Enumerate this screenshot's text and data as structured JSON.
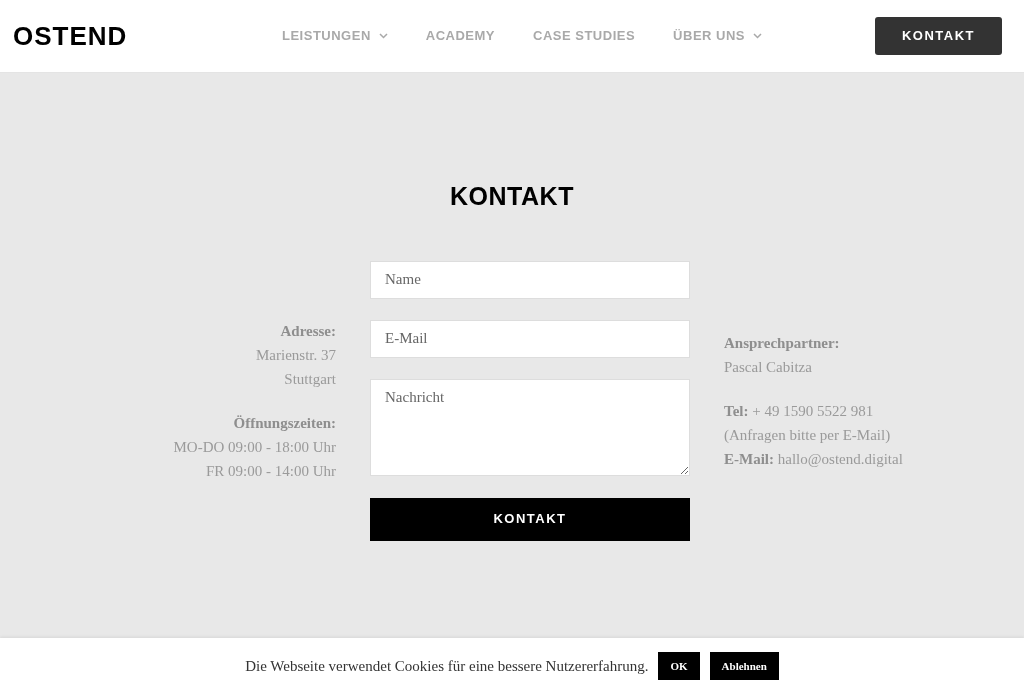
{
  "header": {
    "logo": "OSTEND",
    "nav": [
      {
        "label": "LEISTUNGEN",
        "has_menu": true
      },
      {
        "label": "ACADEMY",
        "has_menu": false
      },
      {
        "label": "CASE STUDIES",
        "has_menu": false
      },
      {
        "label": "ÜBER UNS",
        "has_menu": true
      }
    ],
    "cta": "KONTAKT"
  },
  "contact": {
    "title": "KONTAKT",
    "left_info": [
      [
        {
          "kind": "heading",
          "text": "Adresse:"
        },
        {
          "kind": "text",
          "text": "Marienstr. 37"
        },
        {
          "kind": "text",
          "text": "Stuttgart"
        }
      ],
      [
        {
          "kind": "heading",
          "text": "Öffnungszeiten:"
        },
        {
          "kind": "text",
          "text": "MO-DO 09:00 - 18:00 Uhr"
        },
        {
          "kind": "text",
          "text": "FR 09:00 - 14:00 Uhr"
        }
      ]
    ],
    "form": {
      "fields": [
        {
          "kind": "input",
          "placeholder": "Name"
        },
        {
          "kind": "input",
          "placeholder": "E-Mail"
        },
        {
          "kind": "textarea",
          "placeholder": "Nachricht"
        }
      ],
      "submit": "KONTAKT"
    },
    "right_info": [
      [
        {
          "kind": "heading",
          "text": "Ansprechpartner:"
        },
        {
          "kind": "text",
          "text": "Pascal Cabitza"
        }
      ],
      [
        {
          "kind": "text",
          "text": "**Tel:** + 49 1590 5522 981"
        },
        {
          "kind": "text",
          "text": "(Anfragen bitte per E-Mail)"
        },
        {
          "kind": "text",
          "text": "**E-Mail:** hallo@ostend.digital"
        }
      ]
    ]
  },
  "cookie_bar": {
    "message": "Die Webseite verwendet Cookies für eine bessere Nutzererfahrung.",
    "buttons": [
      "OK",
      "Ablehnen"
    ]
  }
}
